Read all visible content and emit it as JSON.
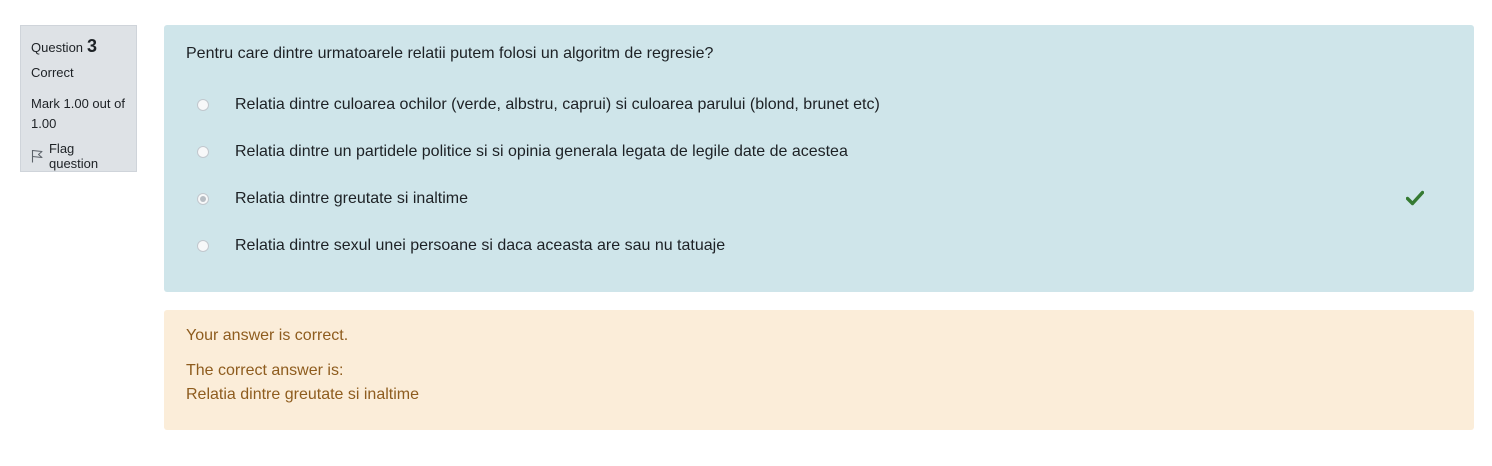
{
  "info": {
    "question_label": "Question",
    "question_number": "3",
    "state": "Correct",
    "grade": "Mark 1.00 out of 1.00",
    "flag_label": "Flag question"
  },
  "question": {
    "text": "Pentru care dintre urmatoarele relatii putem folosi un algoritm de regresie?",
    "answers": [
      {
        "label": "Relatia dintre culoarea ochilor (verde, albstru, caprui) si culoarea parului (blond, brunet etc)",
        "selected": false
      },
      {
        "label": "Relatia dintre un partidele politice si si opinia generala legata de legile date de acestea",
        "selected": false
      },
      {
        "label": "Relatia dintre greutate si inaltime",
        "selected": true,
        "correct_icon": "check-icon"
      },
      {
        "label": "Relatia dintre sexul unei persoane si daca aceasta are sau nu tatuaje",
        "selected": false
      }
    ]
  },
  "feedback": {
    "status": "Your answer is correct.",
    "correct_answer_label": "The correct answer is:",
    "correct_answer": "Relatia dintre greutate si inaltime"
  },
  "colors": {
    "formulation_bg": "#cfe5ea",
    "feedback_bg": "#fbedd9",
    "feedback_text": "#8e5c1e",
    "check_green": "#357a32",
    "info_bg": "#dee2e6"
  }
}
